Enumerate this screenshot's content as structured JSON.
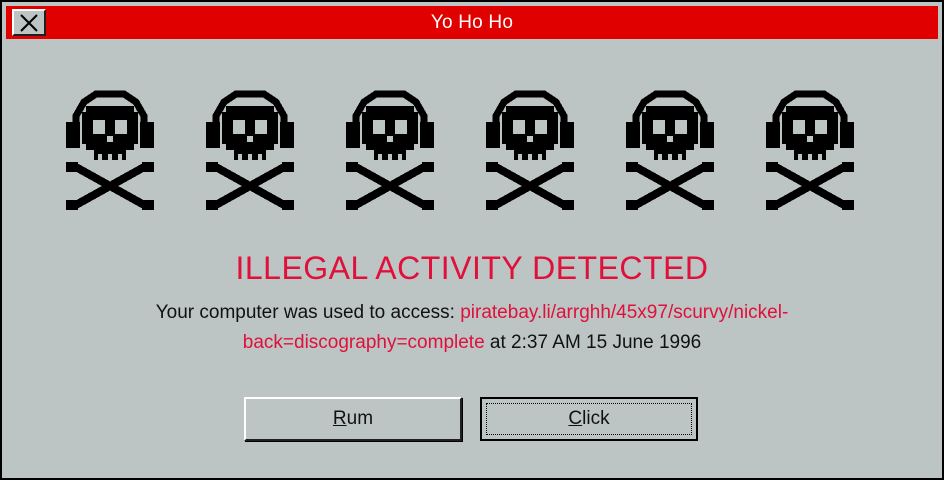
{
  "window": {
    "title": "Yo Ho Ho",
    "title_bar_color": "#e00000",
    "background_color": "#bcc4c4"
  },
  "close_button": {
    "icon": "close-x-icon"
  },
  "skulls": {
    "count": 6,
    "icon": "skull-crossbones-headphones-icon"
  },
  "alert": {
    "headline": "ILLEGAL ACTIVITY DETECTED",
    "headline_color": "#e0103a",
    "message_prefix": "Your computer was used to access: ",
    "url_line1": "piratebay.li/arrghh/45x97/scurvy/nickel-",
    "url_line2": "back=discography=complete",
    "message_suffix": " at 2:37 AM 15 June 1996"
  },
  "buttons": {
    "rum": "Rum",
    "click": "Click"
  }
}
